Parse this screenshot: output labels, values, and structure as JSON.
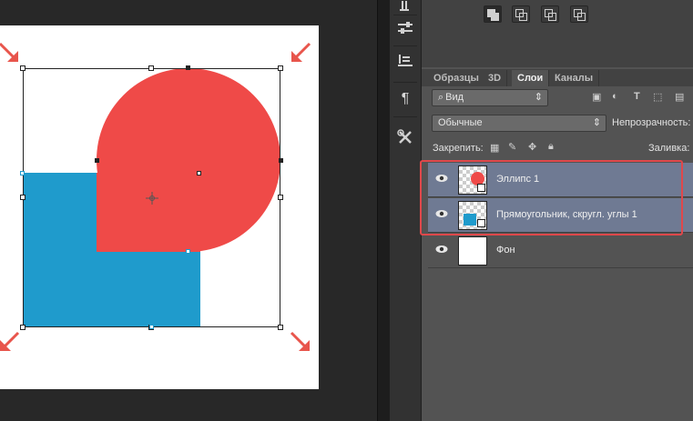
{
  "colors": {
    "ellipse": "#ef4a48",
    "rectangle": "#1f9bcc",
    "selection_highlight": "#e0484b",
    "arrow": "#e8554c"
  },
  "tools": [
    {
      "icon": "brush-presets-icon"
    },
    {
      "icon": "adjustments-sliders-icon"
    },
    {
      "icon": "character-styles-icon"
    },
    {
      "icon": "paragraph-icon",
      "label": "¶"
    },
    {
      "icon": "tools-icon"
    }
  ],
  "align_buttons": [
    "unite-shapes-icon",
    "subtract-shape-icon",
    "intersect-shapes-icon",
    "exclude-overlap-icon"
  ],
  "panel": {
    "tabs": [
      {
        "label": "Образцы"
      },
      {
        "label": "3D"
      },
      {
        "label": "Слои"
      },
      {
        "label": "Каналы"
      }
    ],
    "filter_label": "Вид",
    "blend_mode": "Обычные",
    "opacity_label": "Непрозрачность:",
    "lock_label": "Закрепить:",
    "fill_label": "Заливка:"
  },
  "layers": [
    {
      "name": "Эллипс 1",
      "selected": true,
      "thumb": "ellipse"
    },
    {
      "name": "Прямоугольник, скругл. углы 1",
      "selected": true,
      "thumb": "rect"
    },
    {
      "name": "Фон",
      "selected": false,
      "thumb": "background"
    }
  ]
}
